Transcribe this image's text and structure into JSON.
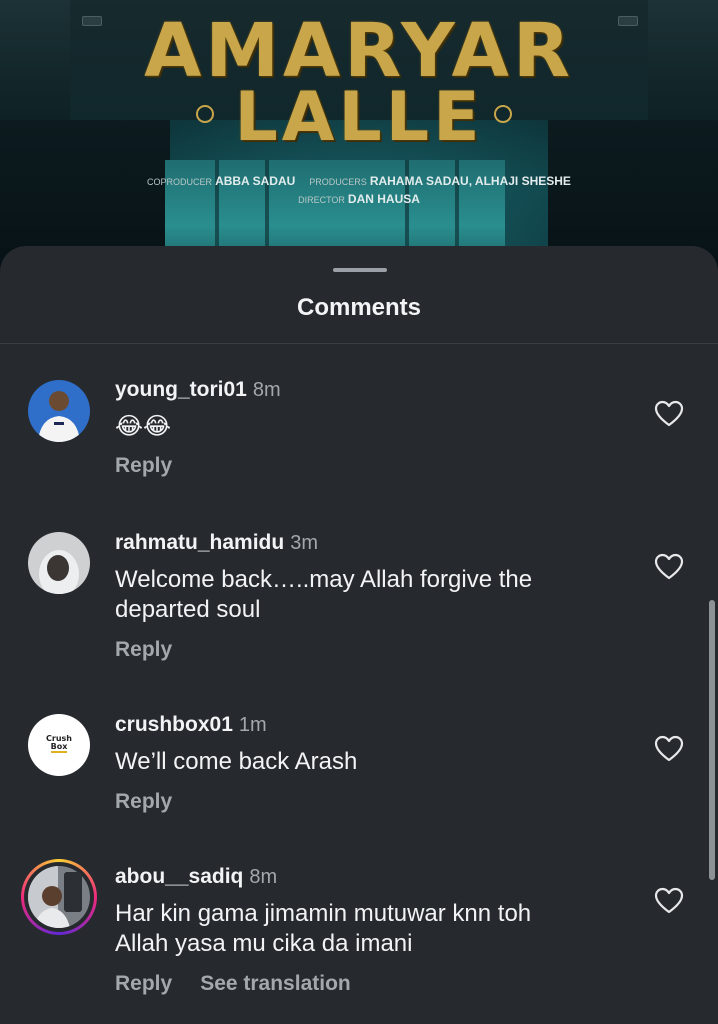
{
  "poster": {
    "title_line1": "AMARYAR",
    "title_line2": "LALLE",
    "coproducer_label": "COPRODUCER",
    "coproducer_name": "ABBA SADAU",
    "producers_label": "PRODUCERS",
    "producers_names": "RAHAMA SADAU, ALHAJI SHESHE",
    "director_label": "DIRECTOR",
    "director_name": "DAN HAUSA",
    "title_color": "#c9a64a"
  },
  "sheet": {
    "title": "Comments",
    "background": "#262a2f"
  },
  "comments": [
    {
      "username": "young_tori01",
      "time": "8m",
      "text": "😂😂",
      "reply_label": "Reply",
      "like_icon": "heart-outline-icon"
    },
    {
      "username": "rahmatu_hamidu",
      "time": "3m",
      "text_line1": "Welcome back…..may Allah forgive the",
      "text_line2": "departed soul",
      "reply_label": "Reply",
      "like_icon": "heart-outline-icon"
    },
    {
      "username": "crushbox01",
      "time": "1m",
      "text": "We’ll come back Arash",
      "reply_label": "Reply",
      "avatar_text_line1": "Crush",
      "avatar_text_line2": "Box",
      "like_icon": "heart-outline-icon"
    },
    {
      "username": "abou__sadiq",
      "time": "8m",
      "text_line1": "Har kin gama jimamin mutuwar knn toh",
      "text_line2": "Allah yasa mu cika da imani",
      "reply_label": "Reply",
      "translate_label": "See translation",
      "like_icon": "heart-outline-icon",
      "has_story_ring": true
    }
  ]
}
